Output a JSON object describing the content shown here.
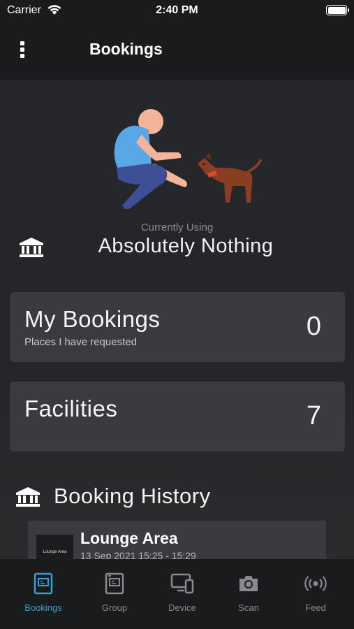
{
  "status_bar": {
    "carrier": "Carrier",
    "time": "2:40 PM"
  },
  "nav": {
    "title": "Bookings"
  },
  "current": {
    "label": "Currently Using",
    "value": "Absolutely Nothing"
  },
  "cards": {
    "my_bookings": {
      "title": "My Bookings",
      "subtitle": "Places I have requested",
      "count": "0"
    },
    "facilities": {
      "title": "Facilities",
      "count": "7"
    }
  },
  "history": {
    "title": "Booking History",
    "items": [
      {
        "thumb_label": "Lounge Area",
        "place": "Lounge Area",
        "when": "13 Sep 2021 15:25 - 15:29"
      }
    ]
  },
  "tabs": [
    {
      "label": "Bookings",
      "icon": "bookings-icon",
      "active": true
    },
    {
      "label": "Group",
      "icon": "group-icon",
      "active": false
    },
    {
      "label": "Device",
      "icon": "device-icon",
      "active": false
    },
    {
      "label": "Scan",
      "icon": "camera-icon",
      "active": false
    },
    {
      "label": "Feed",
      "icon": "broadcast-icon",
      "active": false
    }
  ],
  "colors": {
    "accent": "#3a9bd6",
    "card": "#3a3b3e",
    "bar": "#1a1b1d"
  }
}
